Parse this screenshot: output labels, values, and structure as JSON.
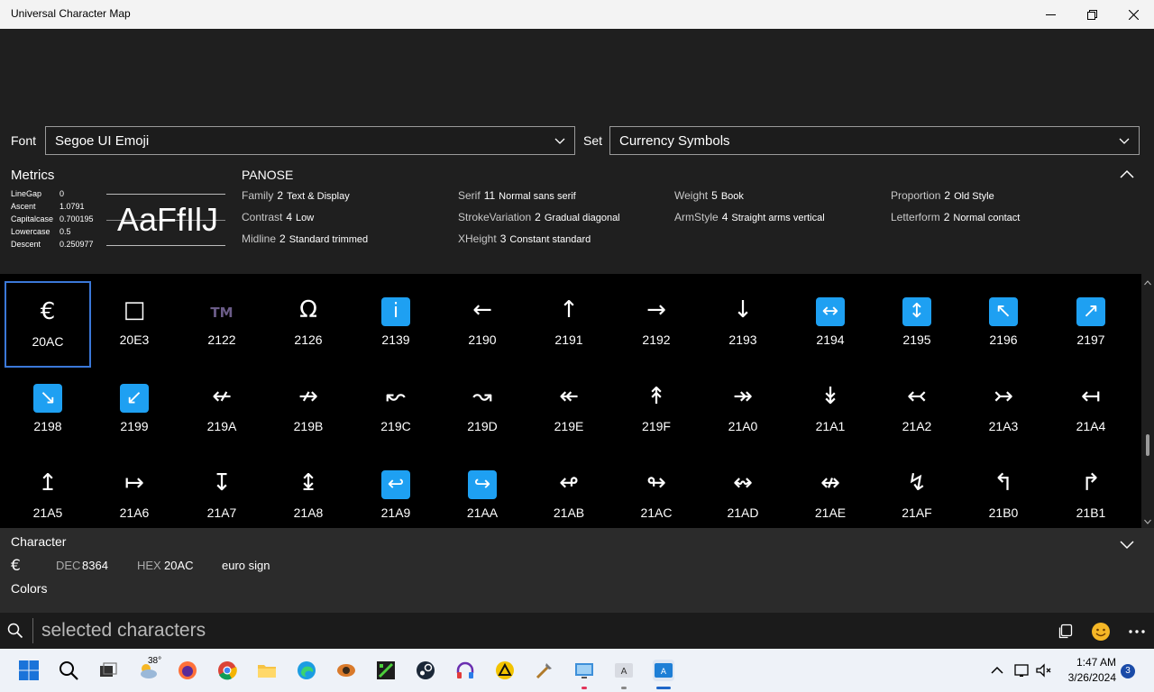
{
  "window": {
    "title": "Universal Character Map"
  },
  "font_selector": {
    "label": "Font",
    "value": "Segoe UI Emoji"
  },
  "set_selector": {
    "label": "Set",
    "value": "Currency Symbols"
  },
  "metrics": {
    "title": "Metrics",
    "rows": [
      {
        "key": "LineGap",
        "value": "0"
      },
      {
        "key": "Ascent",
        "value": "1.0791"
      },
      {
        "key": "Capitalcase",
        "value": "0.700195"
      },
      {
        "key": "Lowercase",
        "value": "0.5"
      },
      {
        "key": "Descent",
        "value": "0.250977"
      }
    ],
    "preview_text": "AaFfIlJ"
  },
  "panose": {
    "title": "PANOSE",
    "items": [
      {
        "name": "Family",
        "value": "2",
        "desc": "Text & Display"
      },
      {
        "name": "Contrast",
        "value": "4",
        "desc": "Low"
      },
      {
        "name": "Midline",
        "value": "2",
        "desc": "Standard trimmed"
      },
      {
        "name": "Serif",
        "value": "11",
        "desc": "Normal sans serif"
      },
      {
        "name": "StrokeVariation",
        "value": "2",
        "desc": "Gradual diagonal"
      },
      {
        "name": "XHeight",
        "value": "3",
        "desc": "Constant standard"
      },
      {
        "name": "Weight",
        "value": "5",
        "desc": "Book"
      },
      {
        "name": "ArmStyle",
        "value": "4",
        "desc": "Straight arms vertical"
      },
      {
        "name": "Proportion",
        "value": "2",
        "desc": "Old Style"
      },
      {
        "name": "Letterform",
        "value": "2",
        "desc": "Normal contact"
      }
    ]
  },
  "grid": {
    "selected_index": 0,
    "cells": [
      {
        "glyph": "€",
        "code": "20AC",
        "style": "text"
      },
      {
        "glyph": "□",
        "code": "20E3",
        "style": "text"
      },
      {
        "glyph": "TM",
        "code": "2122",
        "style": "tm"
      },
      {
        "glyph": "Ω",
        "code": "2126",
        "style": "text"
      },
      {
        "glyph": "i",
        "code": "2139",
        "style": "emoji"
      },
      {
        "glyph": "←",
        "code": "2190",
        "style": "text"
      },
      {
        "glyph": "↑",
        "code": "2191",
        "style": "text"
      },
      {
        "glyph": "→",
        "code": "2192",
        "style": "text"
      },
      {
        "glyph": "↓",
        "code": "2193",
        "style": "text"
      },
      {
        "glyph": "↔",
        "code": "2194",
        "style": "emoji"
      },
      {
        "glyph": "↕",
        "code": "2195",
        "style": "emoji"
      },
      {
        "glyph": "↖",
        "code": "2196",
        "style": "emoji"
      },
      {
        "glyph": "↗",
        "code": "2197",
        "style": "emoji"
      },
      {
        "glyph": "↘",
        "code": "2198",
        "style": "emoji"
      },
      {
        "glyph": "↙",
        "code": "2199",
        "style": "emoji"
      },
      {
        "glyph": "↚",
        "code": "219A",
        "style": "text"
      },
      {
        "glyph": "↛",
        "code": "219B",
        "style": "text"
      },
      {
        "glyph": "↜",
        "code": "219C",
        "style": "text"
      },
      {
        "glyph": "↝",
        "code": "219D",
        "style": "text"
      },
      {
        "glyph": "↞",
        "code": "219E",
        "style": "text"
      },
      {
        "glyph": "↟",
        "code": "219F",
        "style": "text"
      },
      {
        "glyph": "↠",
        "code": "21A0",
        "style": "text"
      },
      {
        "glyph": "↡",
        "code": "21A1",
        "style": "text"
      },
      {
        "glyph": "↢",
        "code": "21A2",
        "style": "text"
      },
      {
        "glyph": "↣",
        "code": "21A3",
        "style": "text"
      },
      {
        "glyph": "↤",
        "code": "21A4",
        "style": "text"
      },
      {
        "glyph": "↥",
        "code": "21A5",
        "style": "text"
      },
      {
        "glyph": "↦",
        "code": "21A6",
        "style": "text"
      },
      {
        "glyph": "↧",
        "code": "21A7",
        "style": "text"
      },
      {
        "glyph": "↨",
        "code": "21A8",
        "style": "text"
      },
      {
        "glyph": "↩",
        "code": "21A9",
        "style": "emoji"
      },
      {
        "glyph": "↪",
        "code": "21AA",
        "style": "emoji"
      },
      {
        "glyph": "↫",
        "code": "21AB",
        "style": "text"
      },
      {
        "glyph": "↬",
        "code": "21AC",
        "style": "text"
      },
      {
        "glyph": "↭",
        "code": "21AD",
        "style": "text"
      },
      {
        "glyph": "↮",
        "code": "21AE",
        "style": "text"
      },
      {
        "glyph": "↯",
        "code": "21AF",
        "style": "text"
      },
      {
        "glyph": "↰",
        "code": "21B0",
        "style": "text"
      },
      {
        "glyph": "↱",
        "code": "21B1",
        "style": "text"
      }
    ]
  },
  "character": {
    "header": "Character",
    "glyph": "€",
    "dec_label": "DEC",
    "dec_value": "8364",
    "hex_label": "HEX",
    "hex_value": "20AC",
    "name": "euro sign",
    "colors_label": "Colors"
  },
  "search": {
    "placeholder": "selected characters"
  },
  "taskbar": {
    "weather_temp": "38°",
    "time": "1:47 AM",
    "date": "3/26/2024",
    "notification_count": "3"
  },
  "colors": {
    "accent": "#3b78d8",
    "emoji_blue": "#1ea0f2",
    "grid_bg": "#000000",
    "app_bg": "#1f1f1f"
  }
}
